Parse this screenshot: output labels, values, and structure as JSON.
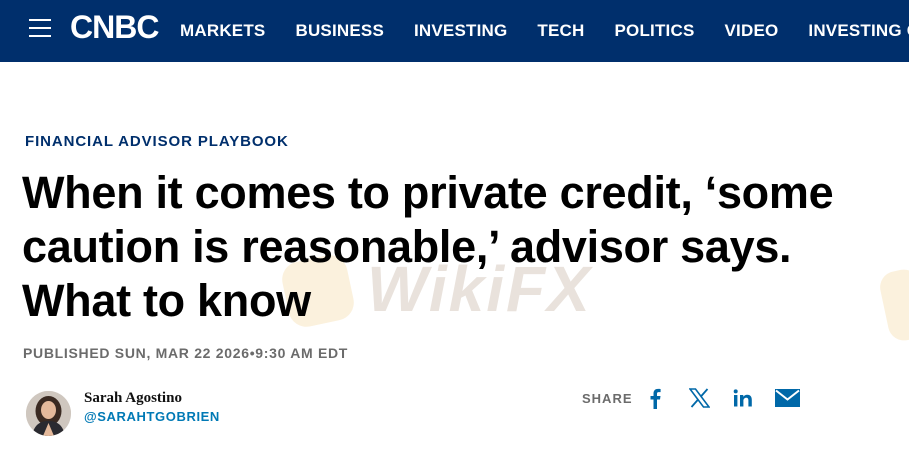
{
  "header": {
    "logo_text": "CNBC",
    "nav": [
      "MARKETS",
      "BUSINESS",
      "INVESTING",
      "TECH",
      "POLITICS",
      "VIDEO",
      "INVESTING CLUB"
    ],
    "background_color": "#002f6c"
  },
  "watermark": {
    "text": "WikiFX"
  },
  "article": {
    "kicker": "FINANCIAL ADVISOR PLAYBOOK",
    "headline_lines": [
      "When it comes to private credit, ‘some",
      "caution is reasonable,’ advisor says.",
      "What to know"
    ],
    "published": "PUBLISHED SUN, MAR 22 2026•9:30 AM EDT"
  },
  "author": {
    "name": "Sarah Agostino",
    "handle": "@SARAHTGOBRIEN",
    "avatar_icon": "author-photo"
  },
  "share": {
    "label": "SHARE",
    "icons": [
      "facebook-icon",
      "x-icon",
      "linkedin-icon",
      "email-icon"
    ],
    "icon_color": "#0068a8"
  }
}
